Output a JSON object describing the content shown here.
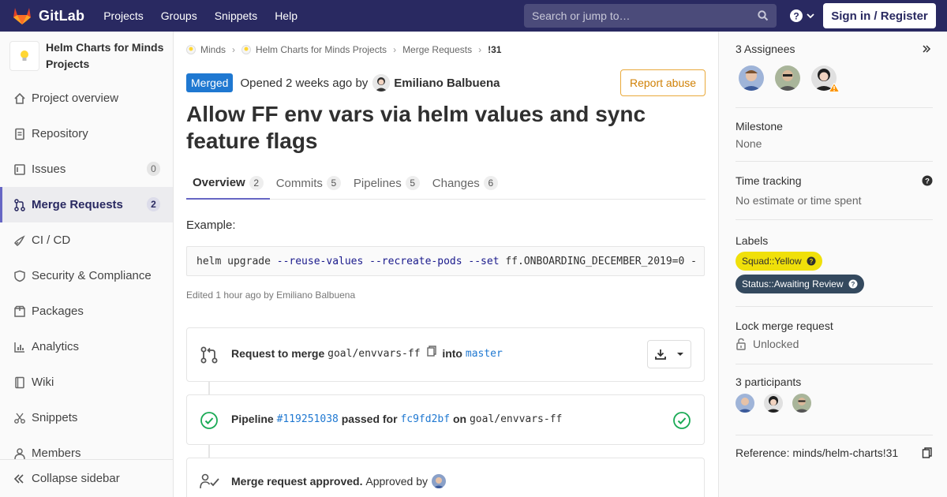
{
  "topbar": {
    "brand": "GitLab",
    "nav": [
      "Projects",
      "Groups",
      "Snippets",
      "Help"
    ],
    "search_placeholder": "Search or jump to…",
    "signin": "Sign in / Register"
  },
  "sidebar": {
    "project_name": "Helm Charts for Minds Projects",
    "items": [
      {
        "label": "Project overview",
        "icon": "home-icon"
      },
      {
        "label": "Repository",
        "icon": "doc-icon"
      },
      {
        "label": "Issues",
        "icon": "issues-icon",
        "badge": "0"
      },
      {
        "label": "Merge Requests",
        "icon": "merge-icon",
        "badge": "2"
      },
      {
        "label": "CI / CD",
        "icon": "rocket-icon"
      },
      {
        "label": "Security & Compliance",
        "icon": "shield-icon"
      },
      {
        "label": "Packages",
        "icon": "package-icon"
      },
      {
        "label": "Analytics",
        "icon": "chart-icon"
      },
      {
        "label": "Wiki",
        "icon": "book-icon"
      },
      {
        "label": "Snippets",
        "icon": "scissors-icon"
      },
      {
        "label": "Members",
        "icon": "users-icon"
      }
    ],
    "collapse": "Collapse sidebar"
  },
  "breadcrumb": [
    "Minds",
    "Helm Charts for Minds Projects",
    "Merge Requests",
    "!31"
  ],
  "mr": {
    "status": "Merged",
    "opened": "Opened",
    "when": "2 weeks ago",
    "by": "by",
    "author": "Emiliano Balbuena",
    "report": "Report abuse",
    "title": "Allow FF env vars via helm values and sync feature flags",
    "tabs": [
      {
        "label": "Overview",
        "count": "2"
      },
      {
        "label": "Commits",
        "count": "5"
      },
      {
        "label": "Pipelines",
        "count": "5"
      },
      {
        "label": "Changes",
        "count": "6"
      }
    ],
    "example": "Example:",
    "code": {
      "cmd": "helm upgrade ",
      "opt1": "--reuse-values",
      "opt2": "--recreate-pods",
      "opt3": "--set",
      "rest": " ff.ONBOARDING_DECEMBER_2019=0 -"
    },
    "edited": "Edited 1 hour ago by Emiliano Balbuena",
    "merge_card": {
      "label": "Request to merge",
      "source": "goal/envvars-ff",
      "into": "into",
      "target": "master"
    },
    "pipeline_card": {
      "label": "Pipeline",
      "id": "#119251038",
      "passed": "passed for",
      "commit": "fc9fd2bf",
      "on": "on",
      "branch": "goal/envvars-ff"
    },
    "approved_card": {
      "label": "Merge request approved.",
      "approved_by": "Approved by"
    }
  },
  "right": {
    "assignees_title": "3 Assignees",
    "milestone_title": "Milestone",
    "milestone_val": "None",
    "time_title": "Time tracking",
    "time_val": "No estimate or time spent",
    "labels_title": "Labels",
    "label1": "Squad::Yellow",
    "label2": "Status::Awaiting Review",
    "lock_title": "Lock merge request",
    "lock_val": "Unlocked",
    "participants_title": "3 participants",
    "reference": "Reference: minds/helm-charts!31"
  },
  "colors": {
    "navbar": "#292961",
    "merged": "#1f78d1",
    "label_yellow": "#f0e00a",
    "label_dark": "#34495e",
    "success": "#1aaa55",
    "report_border": "#e9a93b"
  }
}
